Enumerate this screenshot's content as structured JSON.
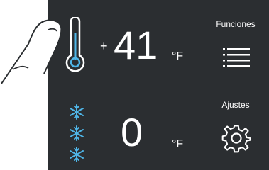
{
  "fridge": {
    "sign": "+",
    "temperature": "41",
    "unit": "°F",
    "icon": "thermometer-icon"
  },
  "freezer": {
    "temperature": "0",
    "unit": "°F",
    "icon": "snowflake-icon"
  },
  "sidebar": {
    "funciones_label": "Funciones",
    "ajustes_label": "Ajustes",
    "funciones_icon": "menu-lines-icon",
    "ajustes_icon": "gear-icon"
  },
  "colors": {
    "panel_bg": "#2b2e31",
    "divider": "#55595d",
    "text": "#ffffff",
    "accent_blue": "#4fb6e8"
  }
}
